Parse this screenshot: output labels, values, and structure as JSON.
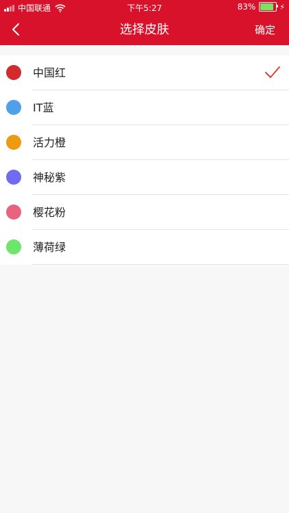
{
  "status_bar": {
    "carrier": "中国联通",
    "time": "下午5:27",
    "battery_text": "83%",
    "battery_level": 0.83,
    "signal_icon": "signal-icon",
    "wifi_icon": "wifi-icon",
    "charging_icon": "charging-bolt-icon"
  },
  "nav": {
    "title": "选择皮肤",
    "confirm_label": "确定",
    "back_icon": "chevron-left-icon",
    "background_color": "#d8122a"
  },
  "skins": [
    {
      "label": "中国红",
      "color": "#d32a2e",
      "selected": true
    },
    {
      "label": "IT蓝",
      "color": "#4ea0e9",
      "selected": false
    },
    {
      "label": "活力橙",
      "color": "#ef9a15",
      "selected": false
    },
    {
      "label": "神秘紫",
      "color": "#6f6cf2",
      "selected": false
    },
    {
      "label": "樱花粉",
      "color": "#e8647e",
      "selected": false
    },
    {
      "label": "薄荷绿",
      "color": "#6ee56b",
      "selected": false
    }
  ],
  "check_color": "#d6452c"
}
